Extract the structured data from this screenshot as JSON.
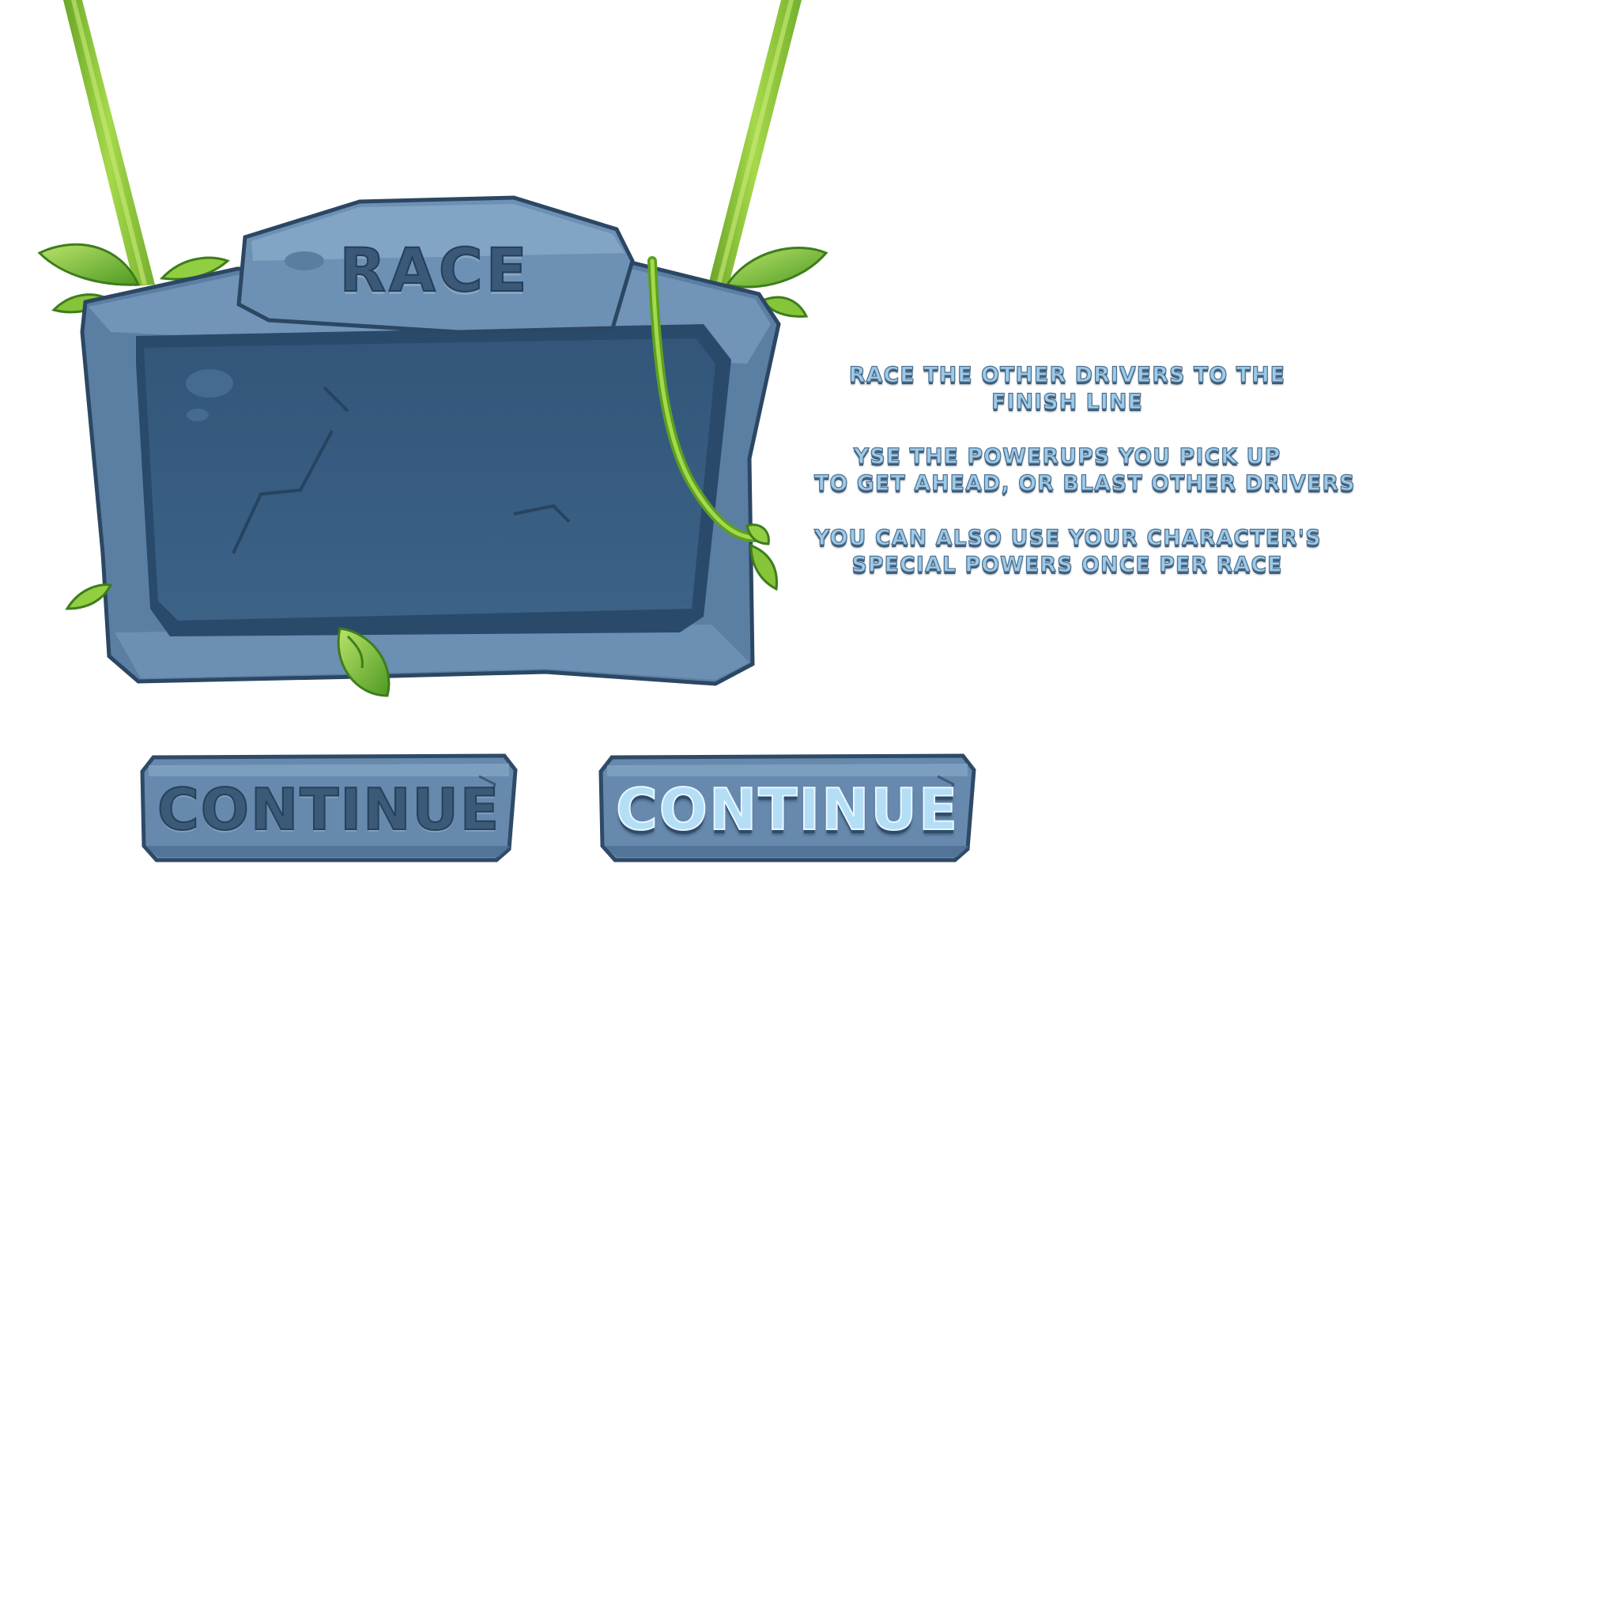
{
  "sign": {
    "title": "RACE"
  },
  "instructions": {
    "paragraphs": [
      [
        "RACE THE OTHER DRIVERS TO THE",
        "FINISH LINE"
      ],
      [
        "YSE THE POWERUPS YOU PICK UP",
        "TO GET AHEAD, OR BLAST OTHER DRIVERS"
      ],
      [
        "YOU CAN ALSO USE YOUR CHARACTER'S",
        "SPECIAL POWERS ONCE PER RACE"
      ]
    ]
  },
  "buttons": {
    "continue_normal": "CONTINUE",
    "continue_hover": "CONTINUE"
  },
  "colors": {
    "stone_light": "#6f92b6",
    "stone_mid": "#4f7396",
    "stone_dark": "#365a7c",
    "vine_green": "#8cc63f",
    "text_light_blue": "#9ccbe9"
  }
}
